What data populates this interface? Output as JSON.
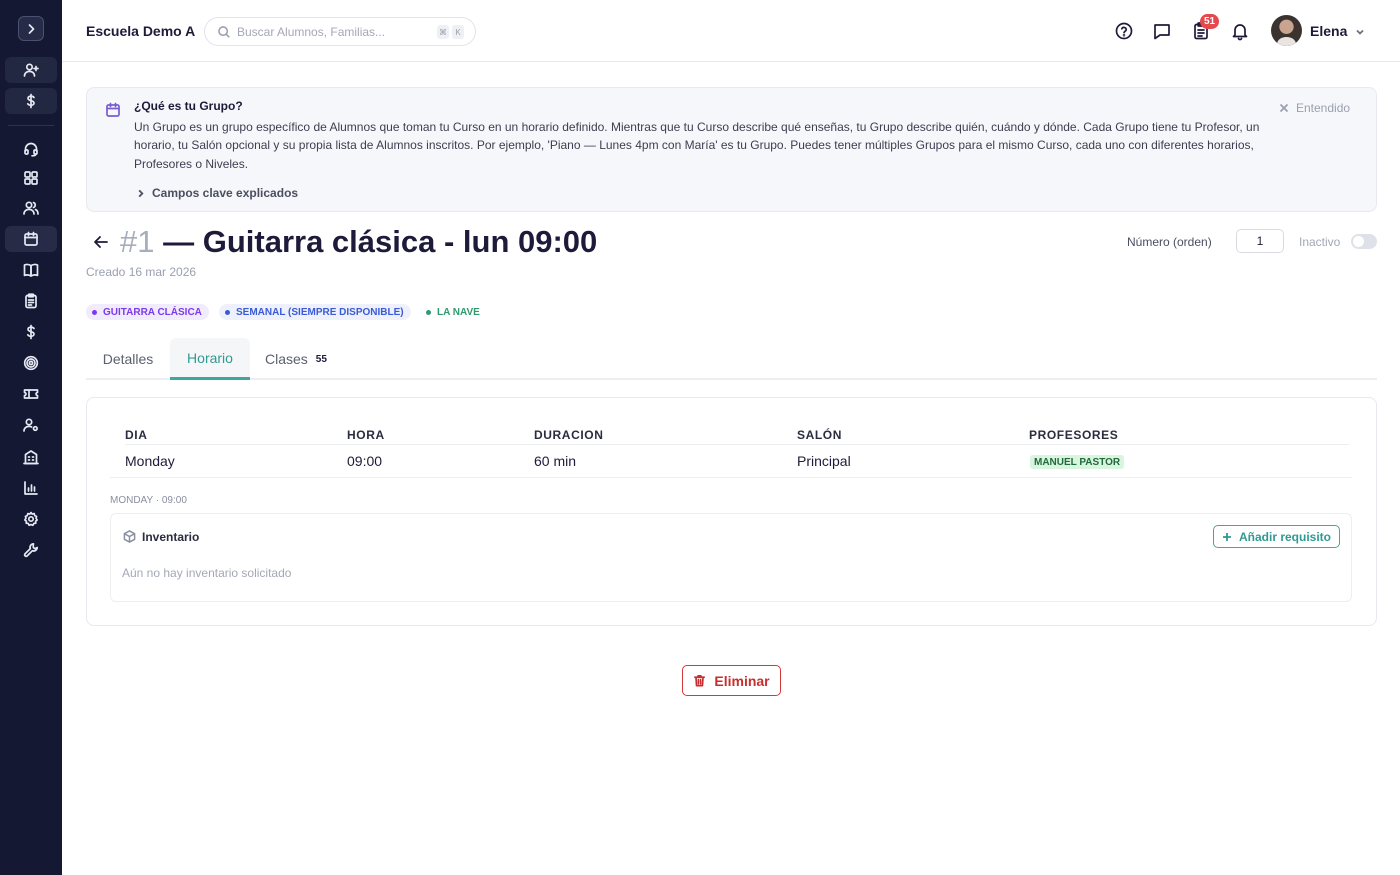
{
  "header": {
    "school_name": "Escuela Demo A",
    "search_placeholder": "Buscar Alumnos, Familias...",
    "shortcut_keys": [
      "⌘",
      "K"
    ],
    "notification_count": "51",
    "user_name": "Elena"
  },
  "sidebar": {
    "icons": [
      "chevron-right-icon",
      "add-user-icon",
      "dollar-icon",
      "headset-icon",
      "dashboard-icon",
      "users-icon",
      "calendar-icon",
      "book-icon",
      "clipboard-icon",
      "dollar-icon",
      "target-icon",
      "ticket-icon",
      "user-settings-icon",
      "building-icon",
      "bar-chart-icon",
      "gear-icon",
      "wrench-icon"
    ],
    "active": "calendar-icon"
  },
  "info": {
    "title": "¿Qué es tu Grupo?",
    "body": "Un Grupo es un grupo específico de Alumnos que toman tu Curso en un horario definido. Mientras que tu Curso describe qué enseñas, tu Grupo describe quién, cuándo y dónde. Cada Grupo tiene tu Profesor, un horario, tu Salón opcional y su propia lista de Alumnos inscritos. Por ejemplo, 'Piano — Lunes 4pm con María' es tu Grupo. Puedes tener múltiples Grupos para el mismo Curso, cada uno con diferentes horarios, Profesores o Niveles.",
    "dismiss_label": "Entendido",
    "expander_label": "Campos clave explicados"
  },
  "group": {
    "number": "#1",
    "title": "— Guitarra clásica - lun 09:00",
    "created": "Creado 16 mar 2026",
    "order_label": "Número (orden)",
    "order_value": "1",
    "status_label": "Inactivo",
    "active": false
  },
  "tags": [
    {
      "label": "GUITARRA CLÁSICA",
      "color": "#7c3aed",
      "bg": "#f1ecfb"
    },
    {
      "label": "SEMANAL (SIEMPRE DISPONIBLE)",
      "color": "#3b5bd6",
      "bg": "#eef1fb"
    },
    {
      "label": "LA NAVE",
      "color": "#2f9a6f",
      "bg": "#ffffff"
    }
  ],
  "tabs": [
    {
      "label": "Detalles"
    },
    {
      "label": "Horario",
      "active": true
    },
    {
      "label": "Clases",
      "count": "55"
    }
  ],
  "schedule": {
    "columns": [
      "DIA",
      "HORA",
      "DURACION",
      "SALÓN",
      "PROFESORES"
    ],
    "rows": [
      {
        "dia": "Monday",
        "hora": "09:00",
        "duracion": "60 min",
        "salon": "Principal",
        "profesores": [
          "MANUEL PASTOR"
        ]
      }
    ],
    "slot_label": "MONDAY · 09:00"
  },
  "inventory": {
    "title": "Inventario",
    "add_label": "Añadir requisito",
    "empty_text": "Aún no hay inventario solicitado"
  },
  "actions": {
    "delete_label": "Eliminar"
  },
  "colors": {
    "sidebar_bg": "#141833",
    "accent": "#2f9a92",
    "danger": "#c62f2f",
    "badge": "#e5484d"
  }
}
